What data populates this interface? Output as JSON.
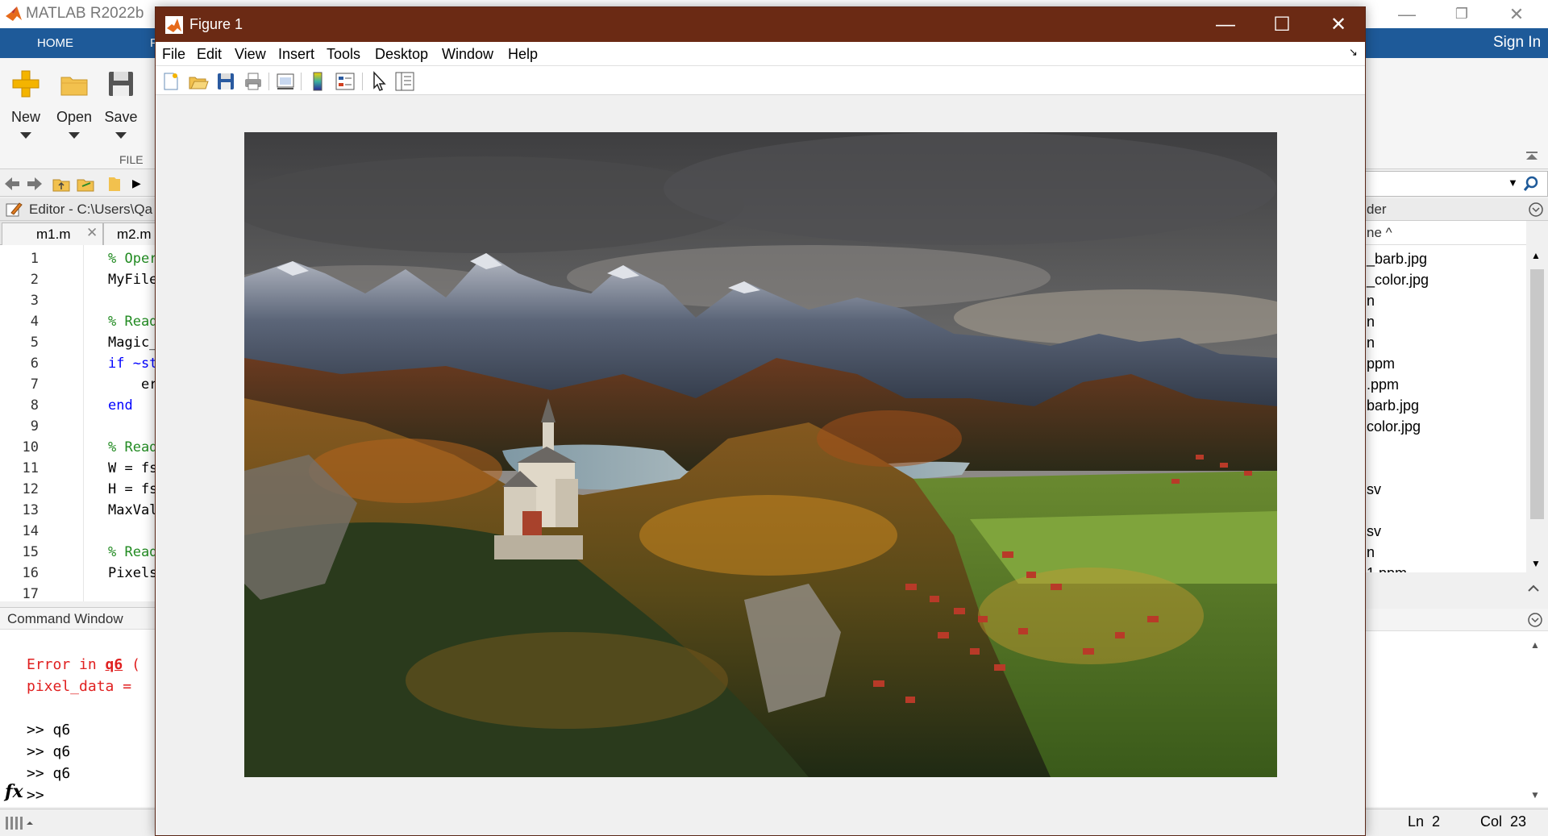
{
  "app": {
    "title": "MATLAB R2022b",
    "window_controls": [
      "—",
      "❐",
      "✕"
    ],
    "ribbon_tabs": [
      "HOME",
      "P"
    ],
    "sign_in": "Sign In"
  },
  "ribbon": {
    "buttons": [
      {
        "label": "New",
        "icon": "new-icon"
      },
      {
        "label": "Open",
        "icon": "open-folder-icon"
      },
      {
        "label": "Save",
        "icon": "save-icon"
      }
    ],
    "group_label": "FILE"
  },
  "editor": {
    "title": "Editor - C:\\Users\\Qa",
    "tabs": [
      "m1.m",
      "m2.m"
    ],
    "line_numbers": [
      "1",
      "2",
      "3",
      "4",
      "5",
      "6",
      "7",
      "8",
      "9",
      "10",
      "11",
      "12",
      "13",
      "14",
      "15",
      "16",
      "17"
    ],
    "lines": [
      {
        "text": "% Oper",
        "kind": "cm"
      },
      {
        "text": "MyFile",
        "kind": "plain"
      },
      {
        "text": "",
        "kind": "plain"
      },
      {
        "text": "% Read",
        "kind": "cm"
      },
      {
        "text": "Magic_",
        "kind": "plain"
      },
      {
        "text": "if ~st",
        "kind": "kw"
      },
      {
        "text": "    er",
        "kind": "plain"
      },
      {
        "text": "end",
        "kind": "kw"
      },
      {
        "text": "",
        "kind": "plain"
      },
      {
        "text": "% Read",
        "kind": "cm"
      },
      {
        "text": "W = fs",
        "kind": "plain"
      },
      {
        "text": "H = fs",
        "kind": "plain"
      },
      {
        "text": "MaxVal",
        "kind": "plain"
      },
      {
        "text": "",
        "kind": "plain"
      },
      {
        "text": "% Read",
        "kind": "cm"
      },
      {
        "text": "Pixels",
        "kind": "plain"
      },
      {
        "text": "",
        "kind": "plain"
      }
    ]
  },
  "command_window": {
    "title": "Command Window",
    "error_line1_prefix": "Error in ",
    "error_line1_link": "q6",
    "error_line1_suffix": " (",
    "error_line2": "pixel_data = ",
    "history": [
      ">> q6",
      ">> q6",
      ">> q6"
    ],
    "prompt": ">>",
    "fx": "fx"
  },
  "current_folder": {
    "title": "der",
    "column_header": "ne ^",
    "files": [
      "_barb.jpg",
      "_color.jpg",
      "n",
      "n",
      "n",
      "ppm",
      ".ppm",
      "barb.jpg",
      "color.jpg",
      "",
      "",
      "sv",
      "",
      "sv",
      "n",
      "1.ppm"
    ]
  },
  "status": {
    "ln_label": "Ln",
    "ln_value": "2",
    "col_label": "Col",
    "col_value": "23"
  },
  "figure": {
    "title": "Figure 1",
    "controls": [
      "—",
      "☐",
      "✕"
    ],
    "menus": [
      "File",
      "Edit",
      "View",
      "Insert",
      "Tools",
      "Desktop",
      "Window",
      "Help"
    ],
    "toolbar_icons": [
      "new-figure-icon",
      "open-file-icon",
      "save-figure-icon",
      "print-icon",
      "link-plot-icon",
      "colorbar-icon",
      "legend-icon",
      "select-arrow-icon",
      "property-inspector-icon"
    ],
    "image_subject": "landscape-photo",
    "dock_icon": "↘"
  },
  "colors": {
    "ribbon_blue": "#1e5a99",
    "figure_titlebar": "#6b2a14",
    "comment_green": "#228b22",
    "keyword_blue": "#0000ff",
    "error_red": "#e02020"
  }
}
